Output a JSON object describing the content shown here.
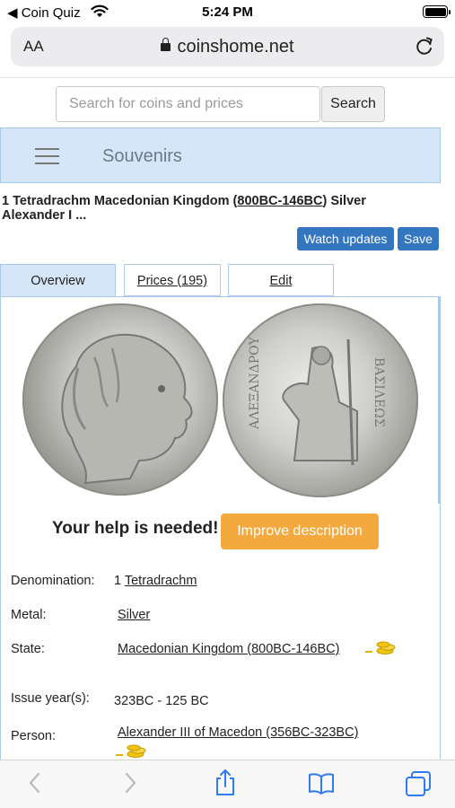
{
  "status_bar": {
    "back_app": "◀ Coin  Quiz",
    "time": "5:24 PM"
  },
  "browser": {
    "text_size_label": "AA",
    "domain": "coinshome.net"
  },
  "search": {
    "placeholder": "Search for coins and prices",
    "button_label": "Search"
  },
  "section_bar": {
    "title": "Souvenirs"
  },
  "coin": {
    "title_prefix": "1 Tetradrachm Macedonian Kingdom (",
    "title_link": "800BC-146BC",
    "title_suffix": ") Silver Alexander I ...",
    "watch_label": "Watch updates",
    "save_label": "Save"
  },
  "tabs": [
    {
      "label": "Overview"
    },
    {
      "label": "Prices (195)"
    },
    {
      "label": "Edit"
    }
  ],
  "help": {
    "text": "Your help is needed!",
    "button_label": "Improve description"
  },
  "attributes": {
    "denomination_label": "Denomination:",
    "denomination_number": "1",
    "denomination_value": "Tetradrachm",
    "metal_label": "Metal:",
    "metal_value": "Silver",
    "state_label": "State:",
    "state_value": "Macedonian Kingdom (800BC-146BC)",
    "issue_label": "Issue year(s):",
    "issue_value": "323BC - 125 BC",
    "person_label": "Person:",
    "person_value": "Alexander III of Macedon (356BC-323BC)"
  },
  "colors": {
    "primary_button": "#3476c0",
    "accent_button": "#f4a93f",
    "section_bg": "#d5e6f8",
    "toolbar_icon": "#2f7bf5"
  },
  "icons": {
    "wifi": "wifi-icon",
    "battery": "battery-icon",
    "lock": "lock-icon",
    "reload": "reload-icon",
    "menu": "hamburger-icon",
    "gold": "gold-coins-icon",
    "back": "chevron-left-icon",
    "forward": "chevron-right-icon",
    "share": "share-icon",
    "bookmarks": "book-icon",
    "tabs": "tabs-icon"
  }
}
